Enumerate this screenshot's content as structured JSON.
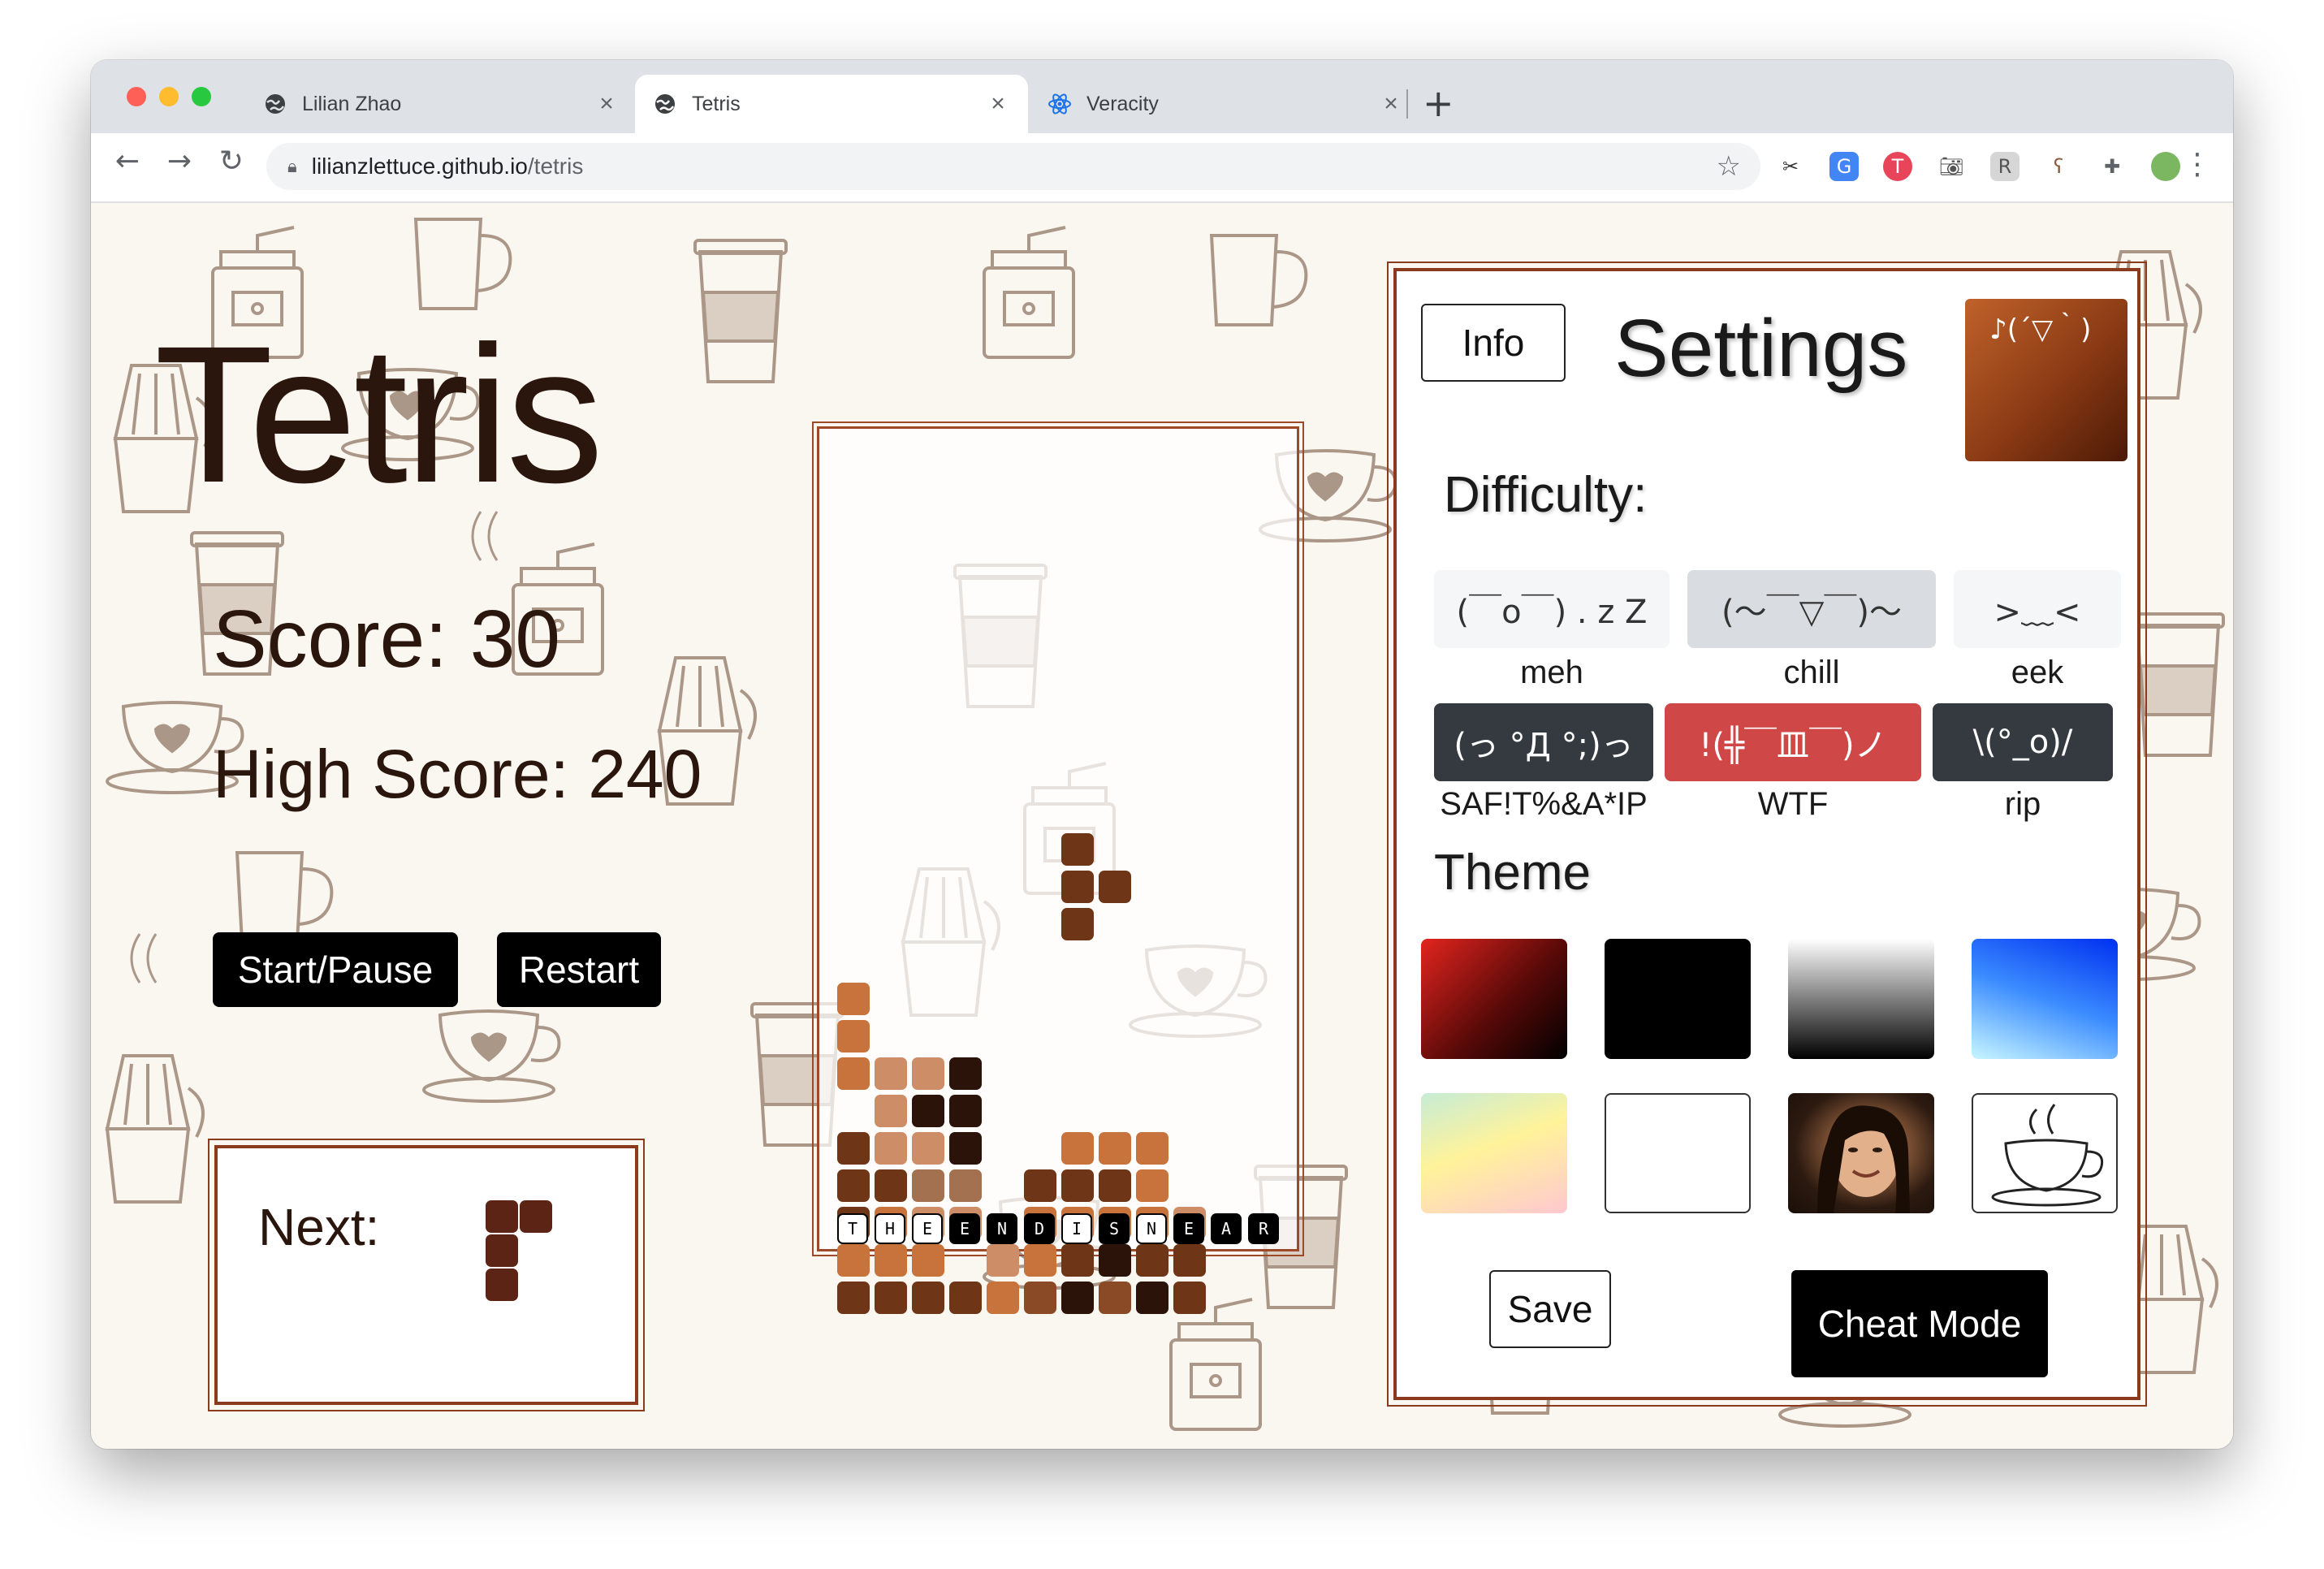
{
  "browser": {
    "tabs": [
      {
        "title": "Lilian Zhao",
        "icon": "globe-icon",
        "active": false
      },
      {
        "title": "Tetris",
        "icon": "globe-icon",
        "active": true
      },
      {
        "title": "Veracity",
        "icon": "react-icon",
        "active": false
      }
    ],
    "close_glyph": "×",
    "new_tab_glyph": "+",
    "url_host": "lilianzlettuce.github.io",
    "url_path": "/tetris",
    "extensions": [
      "scissors-icon",
      "translate-icon",
      "shield-icon",
      "camera-icon",
      "puzzle-ext-icon",
      "bear-icon",
      "extensions-icon",
      "profile-avatar"
    ]
  },
  "game": {
    "title": "Tetris",
    "score_label": "Score: 30",
    "high_score_label": "High Score: 240",
    "start_pause_label": "Start/Pause",
    "restart_label": "Restart",
    "next_label": "Next:",
    "footer_letters": [
      "T",
      "H",
      "E",
      "E",
      "N",
      "D",
      "I",
      "S",
      "N",
      "E",
      "A",
      "R"
    ]
  },
  "settings": {
    "info_label": "Info",
    "title": "Settings",
    "kaomoji": "♪(´▽｀)",
    "difficulty_label": "Difficulty:",
    "difficulties": [
      {
        "face": "(￣o￣) . z Z",
        "name": "meh"
      },
      {
        "face": "(〜￣▽￣)〜",
        "name": "chill"
      },
      {
        "face": ">﹏<",
        "name": "eek"
      },
      {
        "face": "(っ °Д °;)っ",
        "name": "SAF!T%&A*IP"
      },
      {
        "face": "!(╬￣皿￣)ノ",
        "name": "WTF"
      },
      {
        "face": "\\(°_o)/",
        "name": "rip"
      }
    ],
    "theme_label": "Theme",
    "themes": [
      "red-black-gradient",
      "black",
      "white-black-gradient",
      "blue-gradient",
      "pastel-gradient",
      "white",
      "photo",
      "coffee-cup"
    ],
    "save_label": "Save",
    "cheat_label": "Cheat Mode"
  },
  "colors": {
    "brown_dark": "#2a160c",
    "accent_red": "#cf4747",
    "frame_brown": "#8b3a1e"
  }
}
